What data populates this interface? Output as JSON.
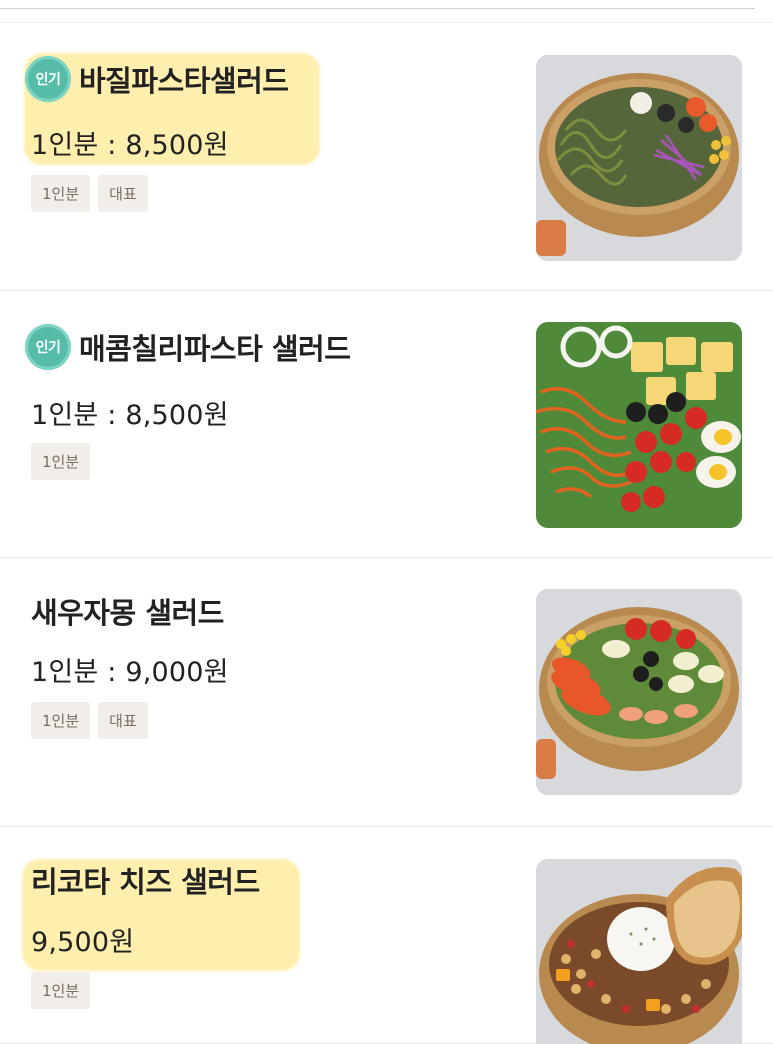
{
  "menu": {
    "items": [
      {
        "name": "바질파스타샐러드",
        "badge": "인기",
        "price": "1인분 : 8,500원",
        "tags": [
          "1인분",
          "대표"
        ],
        "highlighted": true,
        "image_icon": "basil-pasta-salad-photo"
      },
      {
        "name": "매콤칠리파스타 샐러드",
        "badge": "인기",
        "price": "1인분 : 8,500원",
        "tags": [
          "1인분"
        ],
        "highlighted": false,
        "image_icon": "spicy-chili-pasta-salad-photo"
      },
      {
        "name": "새우자몽 샐러드",
        "badge": "",
        "price": "1인분 : 9,000원",
        "tags": [
          "1인분",
          "대표"
        ],
        "highlighted": false,
        "image_icon": "shrimp-grapefruit-salad-photo"
      },
      {
        "name": "리코타 치즈 샐러드",
        "badge": "",
        "price": "9,500원",
        "tags": [
          "1인분"
        ],
        "highlighted": true,
        "image_icon": "ricotta-cheese-salad-photo"
      }
    ]
  },
  "colors": {
    "badge": "#56bca7",
    "tag_bg": "#f1eeea",
    "tag_text": "#7a6e63",
    "highlight": "#ffe682"
  }
}
